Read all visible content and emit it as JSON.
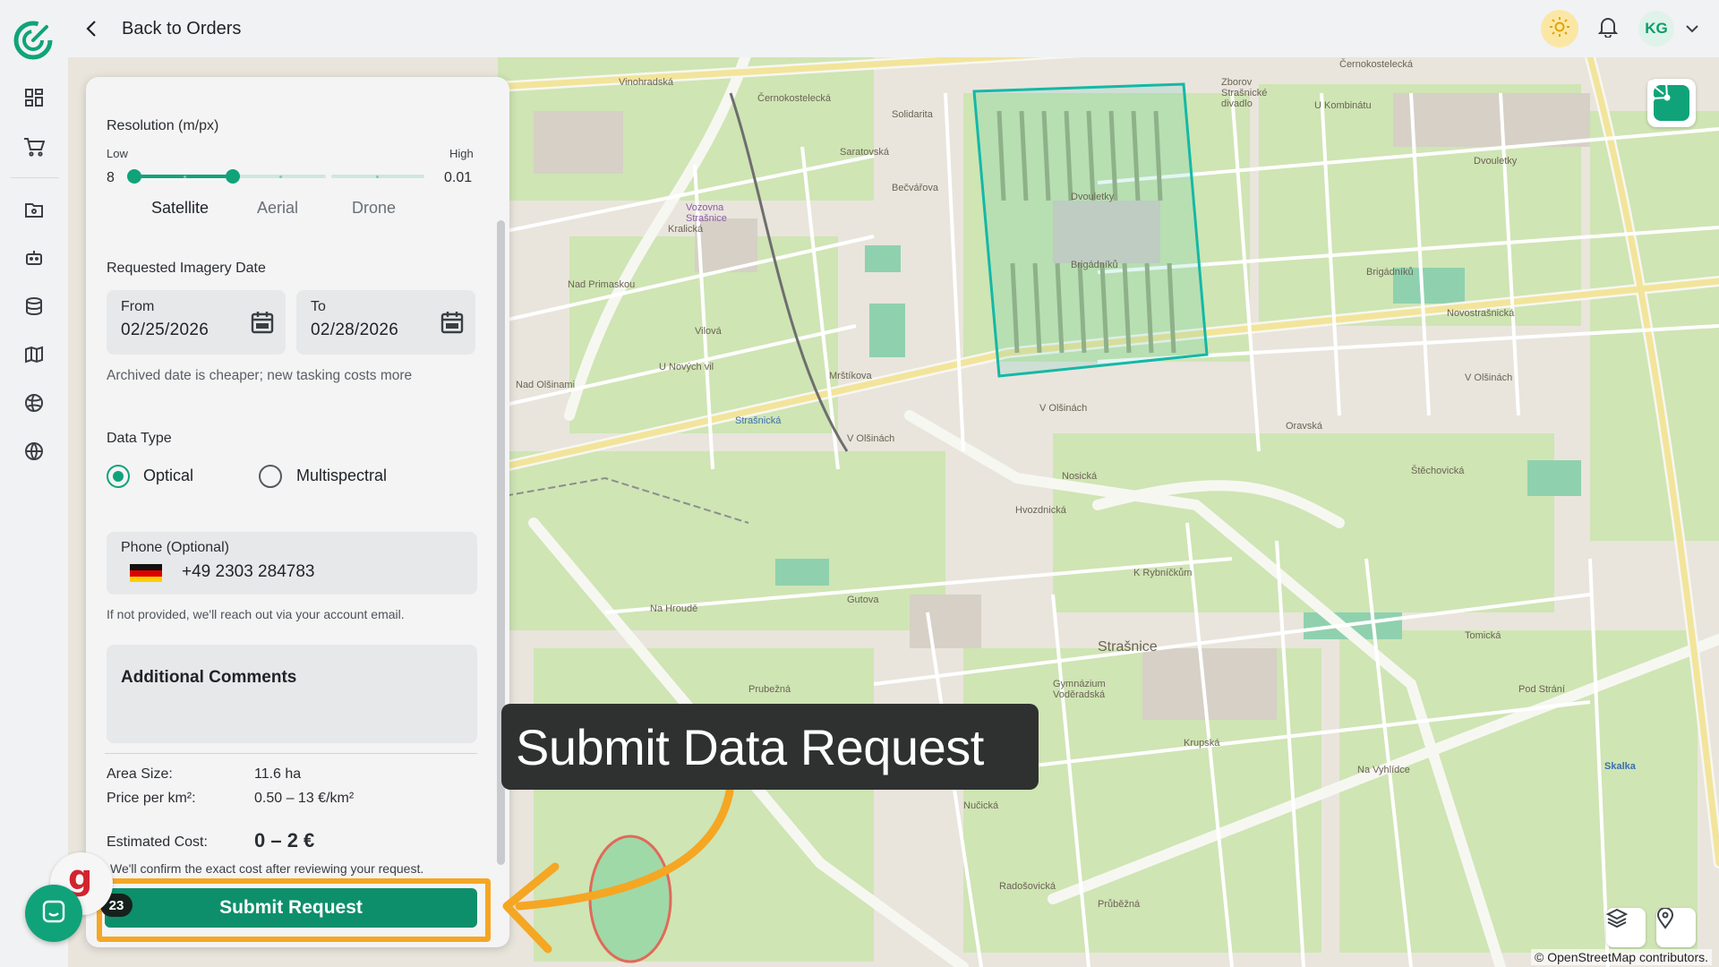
{
  "topbar": {
    "back_label": "Back to Orders",
    "user_initials": "KG"
  },
  "map": {
    "attribution": "© OpenStreetMap contributors.",
    "labels": [
      "Vinohradská",
      "Černokostelecká",
      "Černokostelecká",
      "Solidarita",
      "Zborov Strašnické divadlo",
      "U Kombinátu",
      "Dvouletky",
      "Dvouletky",
      "Brigádníků",
      "Brigádníků",
      "Nad Primaskou",
      "Mrštíkova",
      "Strašnická",
      "V Olšinách",
      "V Olšinách",
      "V Olšinách",
      "Nosická",
      "K Rybníčkům",
      "Hvozdnická",
      "Gutova",
      "Na Hroudě",
      "Strašnice",
      "Gymnázium Voděradská",
      "Prubežná",
      "Průběžná",
      "Nučická",
      "Radošovická",
      "Tomická",
      "Pod Strání",
      "Skalka",
      "Štěchovická",
      "Oravská",
      "Novostrašnická",
      "Kralická",
      "Vozovna Strašnice",
      "Vilová",
      "U Nových vil",
      "Nad Olšinami",
      "Saratovská",
      "Bečvářova",
      "Krupská",
      "Na Vyhlídce"
    ]
  },
  "form": {
    "resolution": {
      "label": "Resolution (m/px)",
      "low_label": "Low",
      "high_label": "High",
      "low_value": "8",
      "high_value": "0.01",
      "selected_range": [
        0,
        0.34
      ],
      "segments": [
        "Satellite",
        "Aerial",
        "Drone"
      ]
    },
    "date": {
      "label": "Requested Imagery Date",
      "from_label": "From",
      "from_value": "02/25/2026",
      "to_label": "To",
      "to_value": "02/28/2026",
      "hint": "Archived date is cheaper; new tasking costs more"
    },
    "data_type": {
      "label": "Data Type",
      "options": [
        "Optical",
        "Multispectral"
      ],
      "selected": "Optical"
    },
    "phone": {
      "label": "Phone (Optional)",
      "value": "+49 2303 284783",
      "hint": "If not provided, we'll reach out via your account email."
    },
    "comments": {
      "label": "Additional Comments"
    },
    "summary": {
      "area_label": "Area Size:",
      "area_value": "11.6 ha",
      "price_label": "Price per km²:",
      "price_value": "0.50 – 13 €/km²",
      "cost_label": "Estimated Cost:",
      "cost_value": "0 – 2 €",
      "note": "We'll confirm the exact cost after reviewing your request."
    },
    "submit_label": "Submit Request"
  },
  "overlay": {
    "callout_text": "Submit Data Request",
    "badge_count": "23",
    "accent_color": "#f5a623"
  },
  "colors": {
    "brand": "#10a37a",
    "submit": "#0e8f6b",
    "polygon": "#14b8a6"
  }
}
